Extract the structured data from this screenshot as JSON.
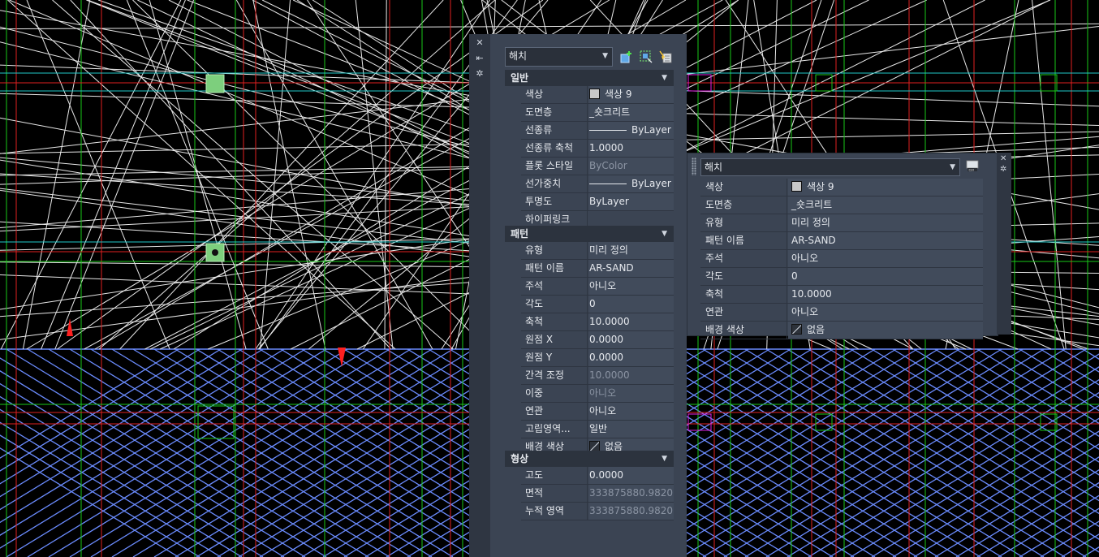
{
  "properties_panel": {
    "object_type": "해치",
    "side_buttons": {
      "close": "✕",
      "autohide": "⇤",
      "settings": "✲"
    },
    "toolbar_icons": [
      "quick-select-icon",
      "select-objects-icon",
      "toggle-pickadd-icon"
    ],
    "sections": {
      "general": {
        "title": "일반",
        "rows": [
          {
            "key": "색상",
            "value": "색상 9"
          },
          {
            "key": "도면층",
            "value": "_숏크리트"
          },
          {
            "key": "선종류",
            "value": "ByLayer"
          },
          {
            "key": "선종류 축척",
            "value": "1.0000"
          },
          {
            "key": "플롯 스타일",
            "value": "ByColor"
          },
          {
            "key": "선가중치",
            "value": "ByLayer"
          },
          {
            "key": "투명도",
            "value": "ByLayer"
          },
          {
            "key": "하이퍼링크",
            "value": ""
          }
        ]
      },
      "pattern": {
        "title": "패턴",
        "rows": [
          {
            "key": "유형",
            "value": "미리 정의"
          },
          {
            "key": "패턴 이름",
            "value": "AR-SAND"
          },
          {
            "key": "주석",
            "value": "아니오"
          },
          {
            "key": "각도",
            "value": "0"
          },
          {
            "key": "축척",
            "value": "10.0000"
          },
          {
            "key": "원점 X",
            "value": "0.0000"
          },
          {
            "key": "원점 Y",
            "value": "0.0000"
          },
          {
            "key": "간격 조정",
            "value": "10.0000"
          },
          {
            "key": "이중",
            "value": "아니오"
          },
          {
            "key": "연관",
            "value": "아니오"
          },
          {
            "key": "고립영역...",
            "value": "일반"
          },
          {
            "key": "배경 색상",
            "value": "없음"
          }
        ]
      },
      "geometry": {
        "title": "형상",
        "rows": [
          {
            "key": "고도",
            "value": "0.0000"
          },
          {
            "key": "면적",
            "value": "333875880.9820"
          },
          {
            "key": "누적 영역",
            "value": "333875880.9820"
          }
        ]
      }
    }
  },
  "quick_properties": {
    "object_type": "해치",
    "rows": [
      {
        "key": "색상",
        "value": "색상 9"
      },
      {
        "key": "도면층",
        "value": "_숏크리트"
      },
      {
        "key": "유형",
        "value": "미리 정의"
      },
      {
        "key": "패턴 이름",
        "value": "AR-SAND"
      },
      {
        "key": "주석",
        "value": "아니오"
      },
      {
        "key": "각도",
        "value": "0"
      },
      {
        "key": "축척",
        "value": "10.0000"
      },
      {
        "key": "연관",
        "value": "아니오"
      },
      {
        "key": "배경 색상",
        "value": "없음"
      }
    ]
  },
  "colors": {
    "canvas_bg": "#000000",
    "panel_bg": "#3b4453",
    "hatch_blue": "#6b8cff",
    "line_white": "#e8e8e8",
    "line_green": "#19c819",
    "line_red": "#e02020",
    "line_cyan": "#20c8c8",
    "accent_magenta": "#e020e0"
  }
}
